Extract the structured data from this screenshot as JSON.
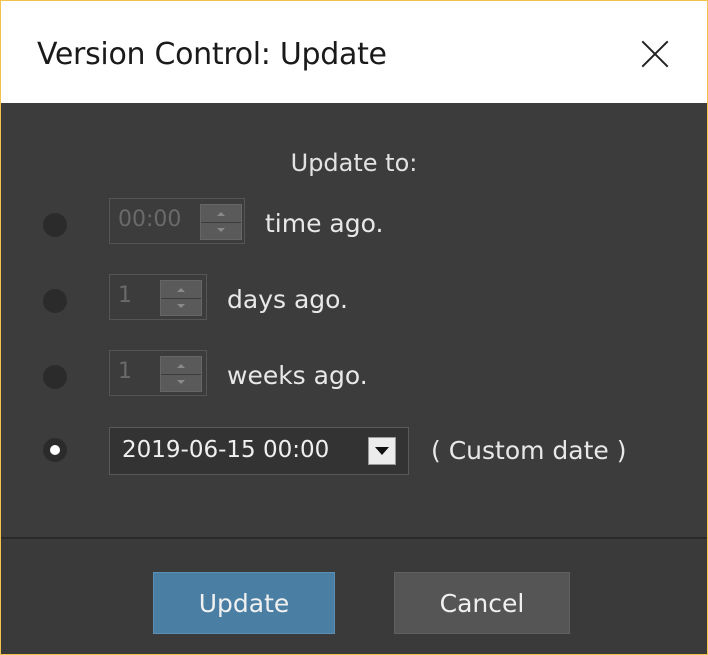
{
  "window": {
    "title": "Version Control: Update"
  },
  "heading": "Update to:",
  "options": [
    {
      "value": "00:00",
      "suffix": "time ago.",
      "selected": false,
      "enabled": false
    },
    {
      "value": "1",
      "suffix": "days ago.",
      "selected": false,
      "enabled": false
    },
    {
      "value": "1",
      "suffix": "weeks ago.",
      "selected": false,
      "enabled": false
    },
    {
      "value": "2019-06-15 00:00",
      "suffix": "( Custom date )",
      "selected": true,
      "enabled": true
    }
  ],
  "buttons": {
    "update": "Update",
    "cancel": "Cancel"
  },
  "icons": {
    "close": "close-icon",
    "spin_up": "chevron-up-icon",
    "spin_down": "chevron-down-icon",
    "dropdown": "dropdown-arrow-icon"
  },
  "colors": {
    "accent": "#4a7fa3",
    "window_border": "#f2c24a",
    "dialog_bg": "#3c3c3c"
  }
}
